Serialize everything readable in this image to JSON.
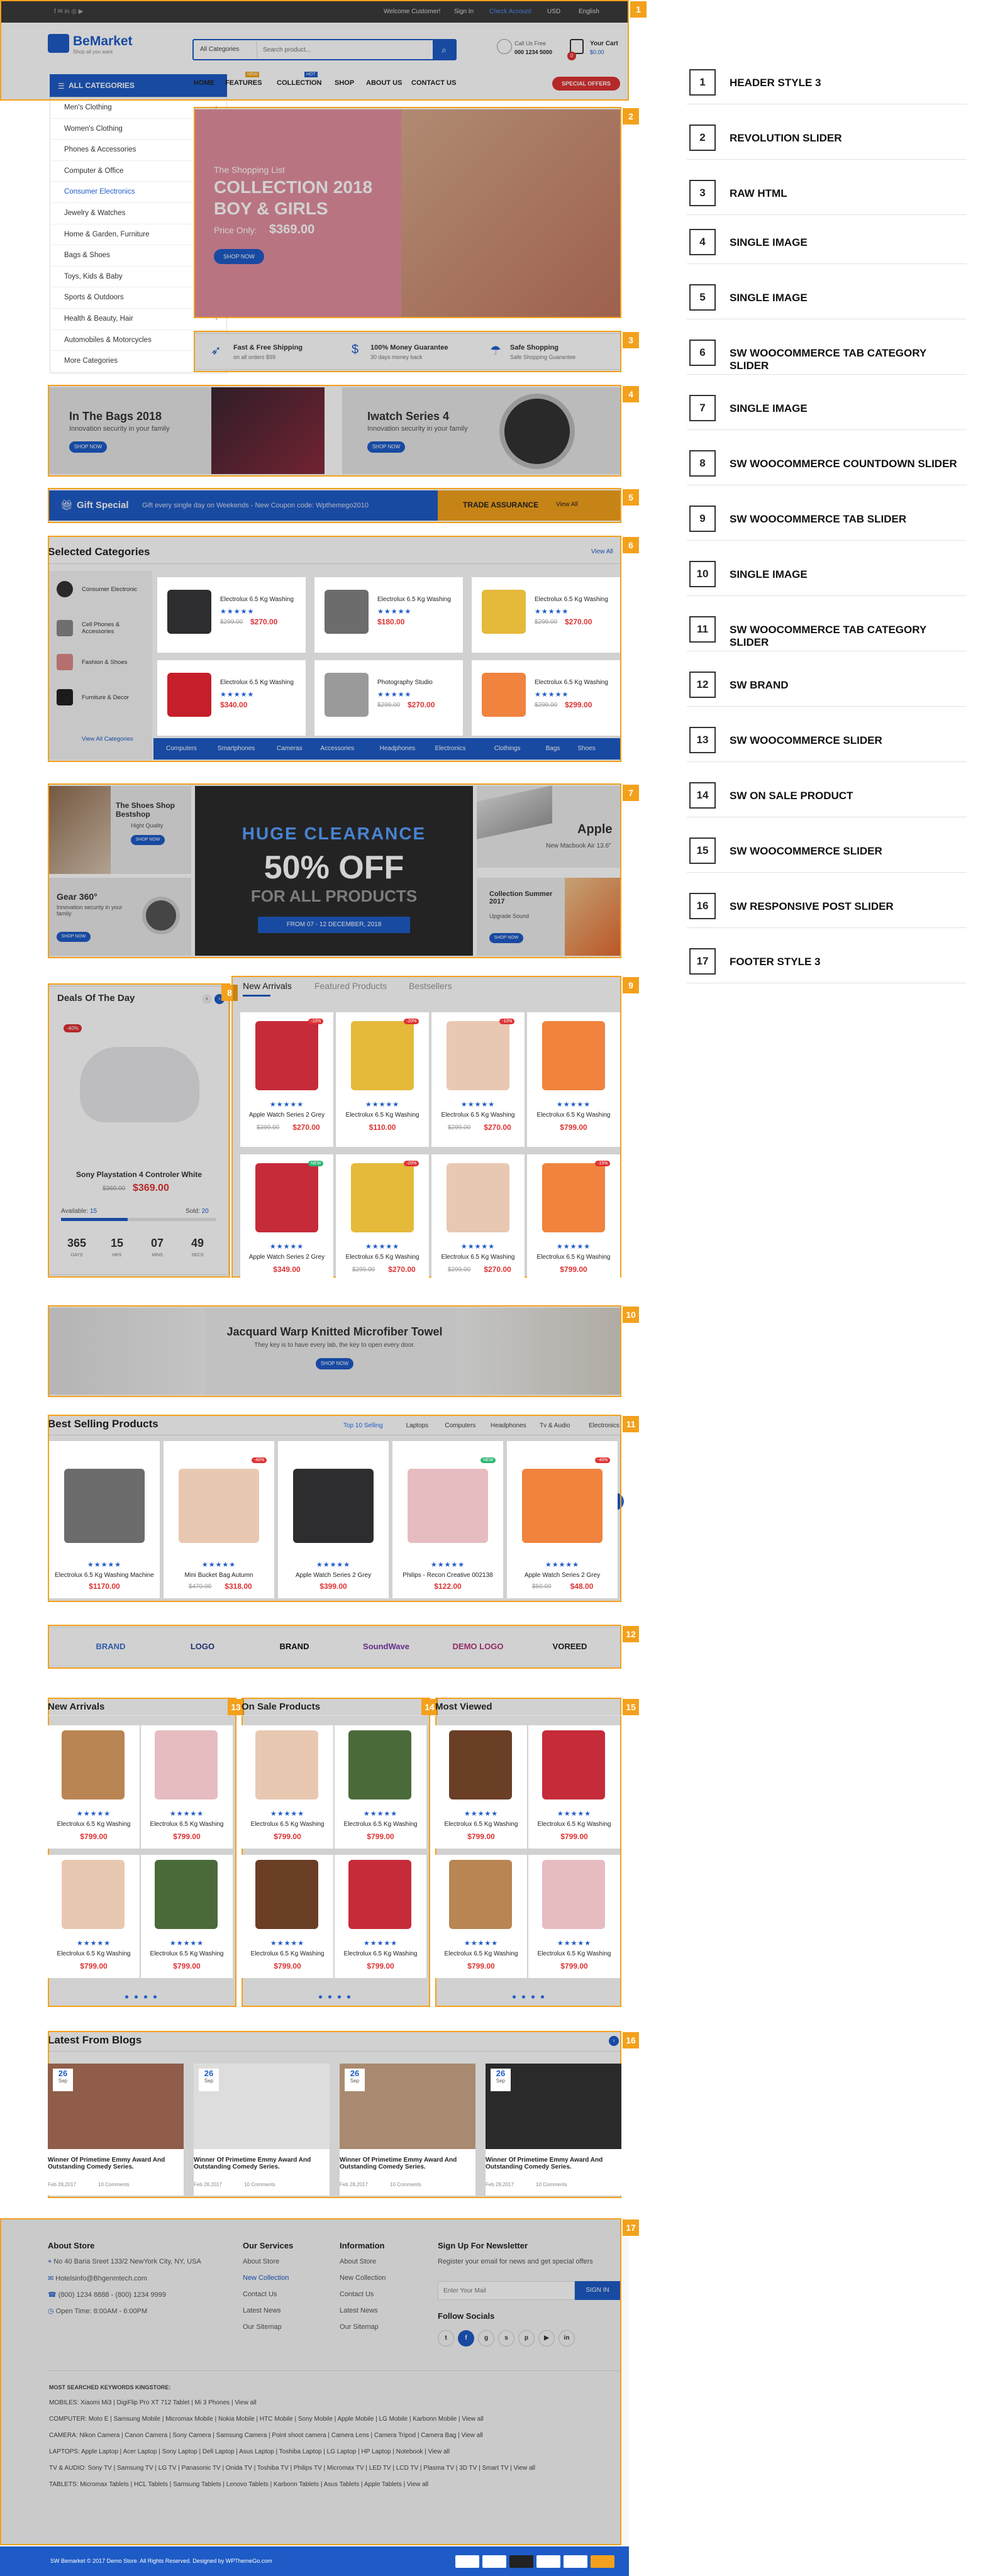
{
  "colors": {
    "accent": "#f3a11c",
    "brand": "#1e5bc6",
    "sale": "#d33"
  },
  "topbar": {
    "welcome": "Welcome Customer!",
    "signin": "Sign In",
    "account": "Check Account",
    "currency": "USD",
    "language": "English"
  },
  "header": {
    "logo": "BeMarket",
    "tagline": "Shop all you want",
    "category_select": "All Categories",
    "search_placeholder": "Search product...",
    "call_label": "Call Us Free",
    "phone": "000 1234 5000",
    "cart_label": "Your Cart",
    "cart_total": "$0.00",
    "cart_count": "0"
  },
  "nav": {
    "all_categories": "ALL CATEGORIES",
    "items": [
      "HOME",
      "FEATURES",
      "COLLECTION",
      "SHOP",
      "ABOUT US",
      "CONTACT US"
    ],
    "badge_new": "NEW",
    "badge_hot": "HOT",
    "special": "SPECIAL OFFERS"
  },
  "side_menu": [
    "Men's Clothing",
    "Women's Clothing",
    "Phones & Accessories",
    "Computer & Office",
    "Consumer Electronics",
    "Jewelry & Watches",
    "Home & Garden, Furniture",
    "Bags & Shoes",
    "Toys, Kids & Baby",
    "Sports & Outdoors",
    "Health & Beauty, Hair",
    "Automobiles & Motorcycles",
    "More Categories"
  ],
  "slider": {
    "line1": "The Shopping List",
    "line2": "COLLECTION 2018",
    "line3": "BOY & GIRLS",
    "price_label": "Price Only:",
    "price": "$369.00",
    "button": "SHOP NOW"
  },
  "features": [
    {
      "title": "Fast & Free Shipping",
      "sub": "on all orders $99"
    },
    {
      "title": "100% Money Guarantee",
      "sub": "30 days money back"
    },
    {
      "title": "Safe Shopping",
      "sub": "Safe Shopping Guarantee"
    }
  ],
  "banners4": [
    {
      "title": "In The Bags 2018",
      "sub": "Innovation security in your family",
      "btn": "SHOP NOW"
    },
    {
      "title": "Iwatch Series 4",
      "sub": "Innovation security in your family",
      "btn": "SHOP NOW"
    }
  ],
  "giftbar": {
    "label": "Gift Special",
    "text": "Gift every single day on Weekends - New Coupon code: Wpthemego2010",
    "trust": "TRADE ASSURANCE",
    "more": "View All"
  },
  "selected": {
    "title": "Selected Categories",
    "view_all": "View All",
    "cats": [
      "Consumer Electronic",
      "Cell Phones & Accessories",
      "Fashion & Shoes",
      "Furniture & Decor"
    ],
    "view_all_cats": "View All Categories",
    "items": [
      {
        "name": "Electrolux 6.5 Kg Washing",
        "old": "$299.00",
        "price": "$270.00"
      },
      {
        "name": "Electrolux 6.5 Kg Washing",
        "old": "",
        "price": "$180.00"
      },
      {
        "name": "Electrolux 6.5 Kg Washing",
        "old": "$299.00",
        "price": "$270.00"
      },
      {
        "name": "Electrolux 6.5 Kg Washing",
        "old": "",
        "price": "$340.00"
      },
      {
        "name": "Photography Studio",
        "old": "$299.00",
        "price": "$270.00"
      },
      {
        "name": "Electrolux 6.5 Kg Washing",
        "old": "$299.00",
        "price": "$299.00"
      }
    ],
    "tabs": [
      "Computers",
      "Smartphones",
      "Cameras",
      "Accessories",
      "Headphones",
      "Electronics",
      "Clothings",
      "Bags",
      "Shoes"
    ]
  },
  "promo7": {
    "shoes_title": "The Shoes Shop Bestshop",
    "shoes_sub": "Hight Quality",
    "gear_title": "Gear 360°",
    "gear_sub": "Innovation security in your family",
    "center1": "HUGE CLEARANCE",
    "center2": "50% OFF",
    "center3": "FOR ALL PRODUCTS",
    "center4": "FROM 07 - 12 DECEMBER, 2018",
    "apple_title": "Apple",
    "apple_sub": "New Macbook Air 13.6\"",
    "coll_title": "Collection Summer 2017",
    "coll_sub": "Upgrade Sound",
    "btn": "SHOP NOW"
  },
  "deal": {
    "title": "Deals Of The Day",
    "badge": "-40%",
    "name": "Sony Playstation 4 Controler White",
    "old": "$369.00",
    "price": "$369.00",
    "available_label": "Available:",
    "available": "15",
    "sold_label": "Sold:",
    "sold": "20",
    "sold_fraction": 0.43,
    "timer": [
      "365",
      "15",
      "07",
      "49"
    ],
    "timer_labels": [
      "DAYS",
      "HRS",
      "MINS",
      "SECS"
    ]
  },
  "tabslider": {
    "tabs": [
      "New Arrivals",
      "Featured Products",
      "Bestsellers"
    ],
    "items": [
      {
        "name": "Apple Watch Series 2 Grey",
        "old": "$399.00",
        "price": "$270.00",
        "badge": "-10%"
      },
      {
        "name": "Electrolux 6.5 Kg Washing",
        "old": "",
        "price": "$110.00",
        "badge": "-20%"
      },
      {
        "name": "Electrolux 6.5 Kg Washing",
        "old": "$299.00",
        "price": "$270.00",
        "badge": "-10%"
      },
      {
        "name": "Electrolux 6.5 Kg Washing",
        "old": "",
        "price": "$799.00",
        "badge": ""
      },
      {
        "name": "Apple Watch Series 2 Grey",
        "old": "",
        "price": "$349.00",
        "badge": "NEW"
      },
      {
        "name": "Electrolux 6.5 Kg Washing",
        "old": "$299.00",
        "price": "$270.00",
        "badge": "-20%"
      },
      {
        "name": "Electrolux 6.5 Kg Washing",
        "old": "$299.00",
        "price": "$270.00",
        "badge": ""
      },
      {
        "name": "Electrolux 6.5 Kg Washing",
        "old": "",
        "price": "$799.00",
        "badge": "-15%"
      }
    ]
  },
  "towel": {
    "title": "Jacquard Warp Knitted Microfiber Towel",
    "sub": "They key is to have every lab, the key to open every door.",
    "btn": "SHOP NOW"
  },
  "best": {
    "title": "Best Selling Products",
    "tabs": [
      "Top 10 Selling",
      "Laptops",
      "Computers",
      "Headphones",
      "Tv & Audio",
      "Electronics"
    ],
    "items": [
      {
        "name": "Electrolux 6.5 Kg Washing Machine",
        "old": "",
        "price": "$1170.00",
        "badge": ""
      },
      {
        "name": "Mini Bucket Bag Autumn",
        "old": "$470.00",
        "price": "$318.00",
        "badge": "-40%"
      },
      {
        "name": "Apple Watch Series 2 Grey",
        "old": "",
        "price": "$399.00",
        "badge": ""
      },
      {
        "name": "Philips - Recon Creative 002138",
        "old": "",
        "price": "$122.00",
        "badge": "NEW"
      },
      {
        "name": "Apple Watch Series 2 Grey",
        "old": "$50.00",
        "price": "$48.00",
        "badge": "-40%"
      }
    ]
  },
  "brands": [
    "BRAND",
    "LOGO",
    "BRAND",
    "SoundWave",
    "DEMO LOGO",
    "VOREED"
  ],
  "cols3": [
    {
      "title": "New Arrivals",
      "items": [
        {
          "name": "Electrolux 6.5 Kg Washing",
          "price": "$799.00"
        },
        {
          "name": "Electrolux 6.5 Kg Washing",
          "price": "$799.00"
        },
        {
          "name": "Electrolux 6.5 Kg Washing",
          "price": "$799.00"
        },
        {
          "name": "Electrolux 6.5 Kg Washing",
          "price": "$799.00"
        }
      ]
    },
    {
      "title": "On Sale Products",
      "items": [
        {
          "name": "Electrolux 6.5 Kg Washing",
          "price": "$799.00"
        },
        {
          "name": "Electrolux 6.5 Kg Washing",
          "price": "$799.00"
        },
        {
          "name": "Electrolux 6.5 Kg Washing",
          "price": "$799.00"
        },
        {
          "name": "Electrolux 6.5 Kg Washing",
          "price": "$799.00"
        }
      ]
    },
    {
      "title": "Most Viewed",
      "items": [
        {
          "name": "Electrolux 6.5 Kg Washing",
          "price": "$799.00"
        },
        {
          "name": "Electrolux 6.5 Kg Washing",
          "price": "$799.00"
        },
        {
          "name": "Electrolux 6.5 Kg Washing",
          "price": "$799.00"
        },
        {
          "name": "Electrolux 6.5 Kg Washing",
          "price": "$799.00"
        }
      ]
    }
  ],
  "blogs": {
    "title": "Latest From Blogs",
    "posts": [
      {
        "day": "26",
        "mon": "Sep",
        "title": "Winner Of Primetime Emmy Award And Outstanding Comedy Series.",
        "date": "Feb 28,2017",
        "comments": "10 Comments"
      },
      {
        "day": "26",
        "mon": "Sep",
        "title": "Winner Of Primetime Emmy Award And Outstanding Comedy Series.",
        "date": "Feb 28,2017",
        "comments": "10 Comments"
      },
      {
        "day": "26",
        "mon": "Sep",
        "title": "Winner Of Primetime Emmy Award And Outstanding Comedy Series.",
        "date": "Feb 28,2017",
        "comments": "10 Comments"
      },
      {
        "day": "26",
        "mon": "Sep",
        "title": "Winner Of Primetime Emmy Award And Outstanding Comedy Series.",
        "date": "Feb 28,2017",
        "comments": "10 Comments"
      }
    ]
  },
  "footer": {
    "about_title": "About Store",
    "address": "No 40 Baria Sreet 133/2 NewYork City, NY, USA",
    "email": "Hotelsinfo@Bhgenmtech.com",
    "phone": "(800) 1234 8888 - (800) 1234 9999",
    "hours": "Open Time: 8:00AM - 6:00PM",
    "services_title": "Our Services",
    "services": [
      "About Store",
      "New Collection",
      "Contact Us",
      "Latest News",
      "Our Sitemap"
    ],
    "info_title": "Information",
    "info": [
      "About Store",
      "New Collection",
      "Contact Us",
      "Latest News",
      "Our Sitemap"
    ],
    "news_title": "Sign Up For Newsletter",
    "news_text": "Register your email for news and get special offers",
    "news_placeholder": "Enter Your Mail",
    "news_btn": "SIGN IN",
    "follow": "Follow Socials",
    "kw_title": "MOST SEARCHED KEYWORDS KINGSTORE:",
    "kw": [
      "MOBILES: Xiaomi Mi3 | DigiFlip Pro XT 712 Tablet | Mi 3 Phones | View all",
      "COMPUTER: Moto E | Samsung Mobile | Micromax Mobile | Nokia Mobile | HTC Mobile | Sony Mobile | Apple Mobile | LG Mobile | Karbonn Mobile | View all",
      "CAMERA: Nikon Camera | Canon Camera | Sony Camera | Samsung Camera | Point shoot camera | Camera Lens | Camera Tripod | Camera Bag | View all",
      "LAPTOPS: Apple Laptop | Acer Laptop | Sony Laptop | Dell Laptop | Asus Laptop | Toshiba Laptop | LG Laptop | HP Laptop | Notebook | View all",
      "TV & AUDIO: Sony TV | Samsung TV | LG TV | Panasonic TV | Onida TV | Toshiba TV | Philips TV | Micromax TV | LED TV | LCD TV | Plasma TV | 3D TV | Smart TV | View all",
      "TABLETS: Micromax Tablets | HCL Tablets | Samsung Tablets | Lenovo Tablets | Karbonn Tablets | Asus Tablets | Apple Tablets | View all"
    ],
    "copyright": "SW Bemarket © 2017 Demo Store. All Rights Reserved. Designed by WPThemeGo.com"
  },
  "legend": [
    {
      "n": "1",
      "label": "HEADER STYLE 3"
    },
    {
      "n": "2",
      "label": "REVOLUTION SLIDER"
    },
    {
      "n": "3",
      "label": "RAW HTML"
    },
    {
      "n": "4",
      "label": "SINGLE IMAGE"
    },
    {
      "n": "5",
      "label": "SINGLE IMAGE"
    },
    {
      "n": "6",
      "label": "SW WOOCOMMERCE TAB CATEGORY SLIDER"
    },
    {
      "n": "7",
      "label": "SINGLE IMAGE"
    },
    {
      "n": "8",
      "label": "SW WOOCOMMERCE COUNTDOWN SLIDER"
    },
    {
      "n": "9",
      "label": "SW WOOCOMMERCE TAB SLIDER"
    },
    {
      "n": "10",
      "label": "SINGLE IMAGE"
    },
    {
      "n": "11",
      "label": "SW WOOCOMMERCE TAB CATEGORY SLIDER"
    },
    {
      "n": "12",
      "label": "SW BRAND"
    },
    {
      "n": "13",
      "label": "SW WOOCOMMERCE SLIDER"
    },
    {
      "n": "14",
      "label": "SW ON SALE PRODUCT"
    },
    {
      "n": "15",
      "label": "SW WOOCOMMERCE SLIDER"
    },
    {
      "n": "16",
      "label": "SW RESPONSIVE POST SLIDER"
    },
    {
      "n": "17",
      "label": "FOOTER STYLE 3"
    }
  ],
  "badges": [
    "1",
    "2",
    "3",
    "4",
    "5",
    "6",
    "7",
    "8",
    "9",
    "10",
    "11",
    "12",
    "13",
    "14",
    "15",
    "16",
    "17"
  ]
}
